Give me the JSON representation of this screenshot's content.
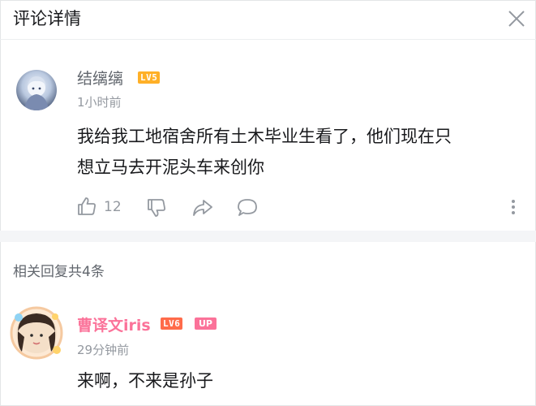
{
  "header": {
    "title": "评论详情"
  },
  "comment": {
    "username": "结缡缡",
    "level": "LV5",
    "time": "1小时前",
    "content_line1": "我给我工地宿舍所有土木毕业生看了，他们现在只",
    "content_line2": "想立马去开泥头车来创你",
    "like_count": "12"
  },
  "replies_header": "相关回复共4条",
  "reply": {
    "username": "曹译文iris",
    "level": "LV6",
    "badge": "UP",
    "time": "29分钟前",
    "content": "来啊，不来是孙子"
  },
  "colors": {
    "accent_pink": "#fb7299",
    "level5": "#ffb027",
    "level6": "#ff6b4a",
    "muted": "#9499a0"
  },
  "icons": [
    "close-icon",
    "thumbs-up-icon",
    "thumbs-down-icon",
    "share-icon",
    "comment-bubble-icon",
    "more-vertical-icon"
  ]
}
